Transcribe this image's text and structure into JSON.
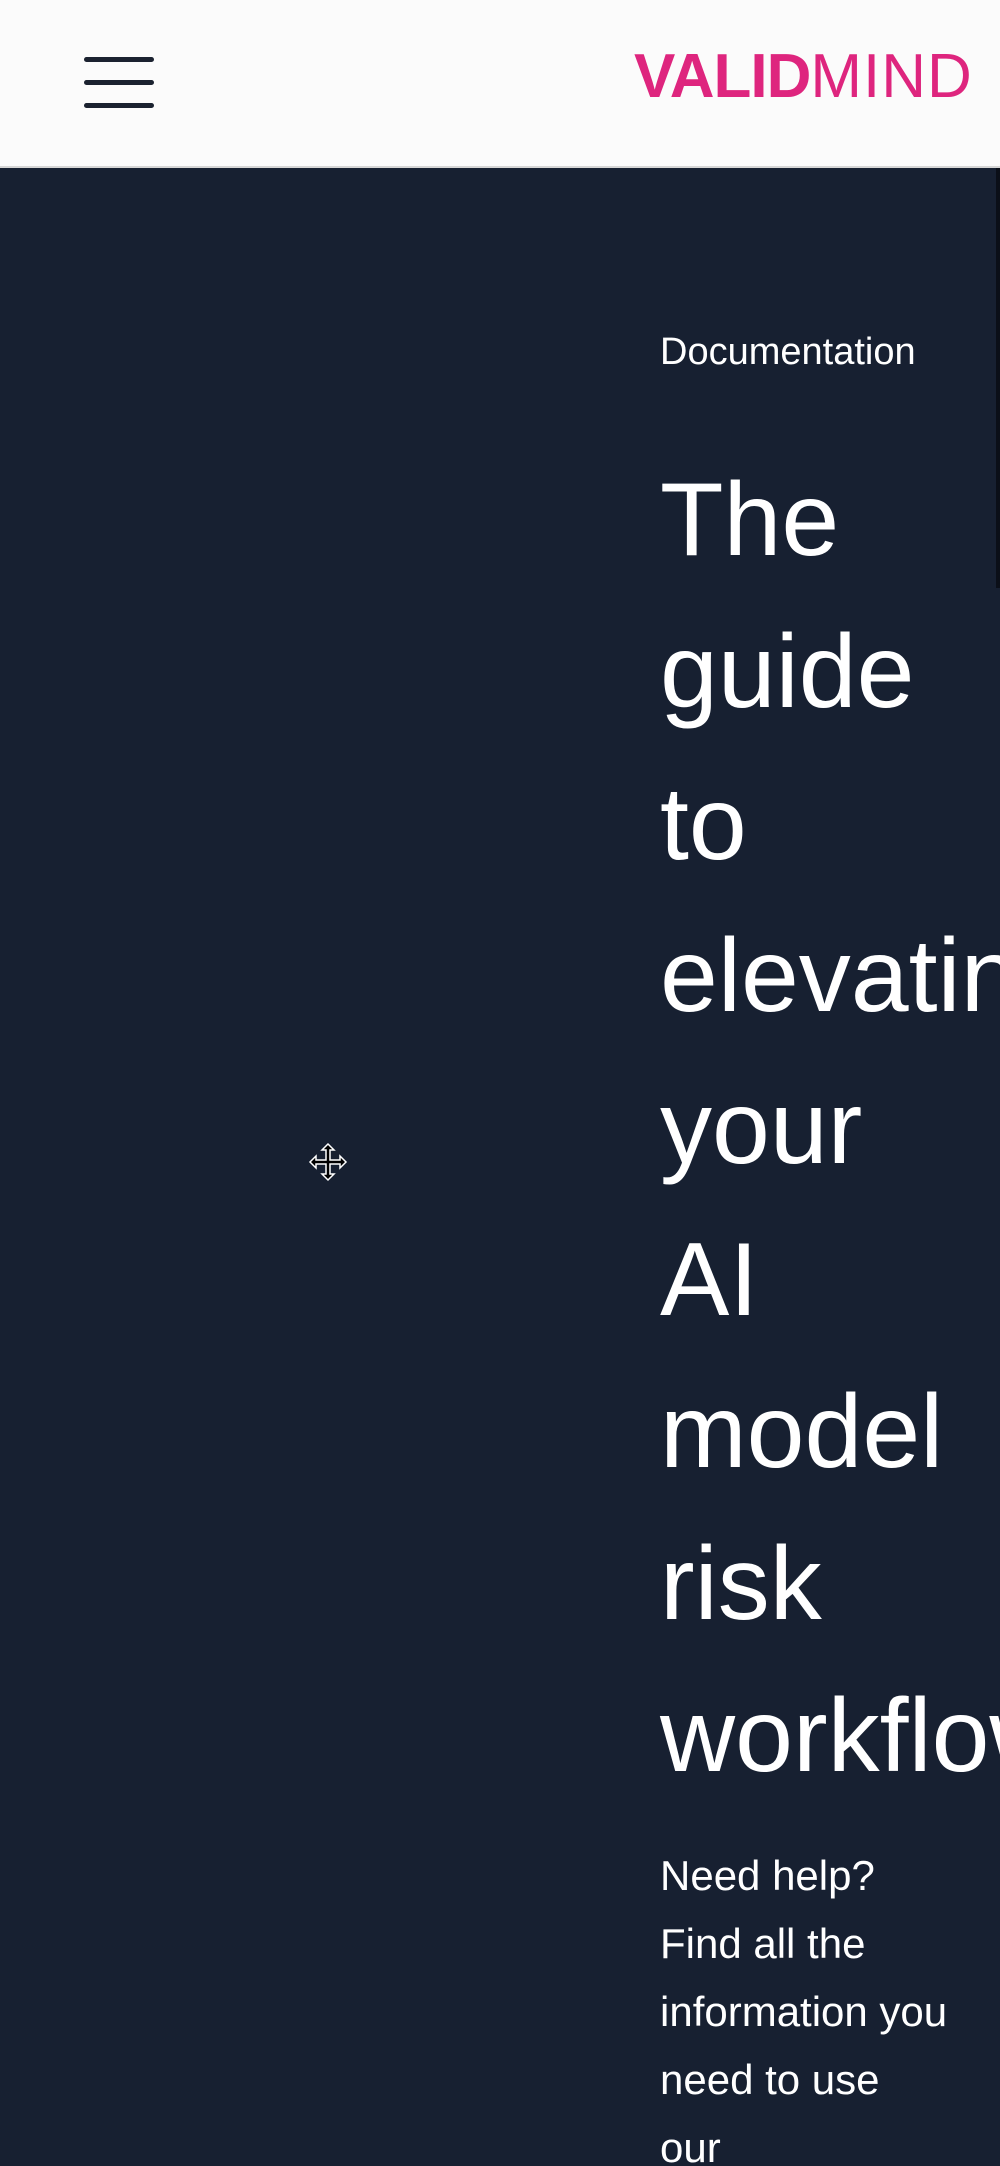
{
  "header": {
    "menu_icon": "hamburger-menu-icon",
    "logo_bold": "VALID",
    "logo_light": "MIND",
    "brand_color": "#de257e"
  },
  "hero": {
    "background": "#172031",
    "eyebrow": "Documentation",
    "headline_words": [
      "The",
      "guide",
      "to",
      "elevating",
      "your",
      "AI",
      "model",
      "risk",
      "workflow"
    ],
    "subtext": "Need help? Find all the information you need to use our",
    "cursor_icon": "move-cursor-icon"
  }
}
